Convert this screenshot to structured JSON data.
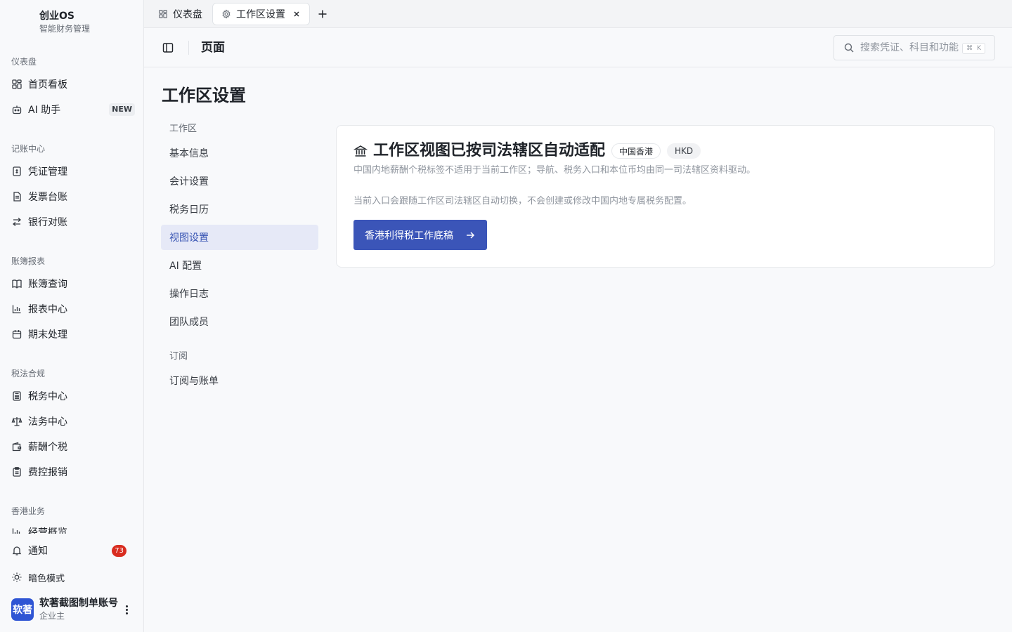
{
  "brand": {
    "name": "创业OS",
    "subtitle": "智能财务管理"
  },
  "sidebar": {
    "groups": [
      {
        "title": "仪表盘",
        "items": [
          {
            "label": "首页看板",
            "icon": "dashboard-grid-icon"
          },
          {
            "label": "AI 助手",
            "icon": "bot-icon",
            "badge": "NEW"
          }
        ]
      },
      {
        "title": "记账中心",
        "items": [
          {
            "label": "凭证管理",
            "icon": "receipt-icon"
          },
          {
            "label": "发票台账",
            "icon": "document-icon"
          },
          {
            "label": "银行对账",
            "icon": "swap-arrows-icon"
          }
        ]
      },
      {
        "title": "账簿报表",
        "items": [
          {
            "label": "账簿查询",
            "icon": "book-icon"
          },
          {
            "label": "报表中心",
            "icon": "bar-chart-icon"
          },
          {
            "label": "期末处理",
            "icon": "calendar-icon"
          }
        ]
      },
      {
        "title": "税法合规",
        "items": [
          {
            "label": "税务中心",
            "icon": "calculator-icon"
          },
          {
            "label": "法务中心",
            "icon": "scale-icon"
          },
          {
            "label": "薪酬个税",
            "icon": "wallet-icon"
          },
          {
            "label": "费控报销",
            "icon": "clipboard-icon"
          }
        ]
      },
      {
        "title": "香港业务",
        "items": [
          {
            "label": "经营概览",
            "icon": "bar-chart-icon"
          }
        ]
      }
    ],
    "bottom": {
      "notifications_label": "通知",
      "notifications_count": "73",
      "dark_mode_label": "暗色模式"
    },
    "user": {
      "avatar_text": "软著",
      "name": "软著截图制单账号",
      "role": "企业主"
    }
  },
  "tabs": [
    {
      "label": "仪表盘",
      "icon": "dashboard-grid-icon",
      "active": false
    },
    {
      "label": "工作区设置",
      "icon": "gear-icon",
      "active": true
    }
  ],
  "header": {
    "title": "页面",
    "search_placeholder": "搜索凭证、科目和功能",
    "search_shortcut_mod": "⌘",
    "search_shortcut_key": "K"
  },
  "main": {
    "page_title": "工作区设置",
    "subnav": [
      {
        "group": "工作区",
        "items": [
          "基本信息",
          "会计设置",
          "税务日历",
          "视图设置",
          "AI 配置",
          "操作日志",
          "团队成员"
        ]
      },
      {
        "group": "订阅",
        "items": [
          "订阅与账单"
        ]
      }
    ],
    "active_subnav": "视图设置",
    "card": {
      "icon": "bank-building-icon",
      "title": "工作区视图已按司法辖区自动适配",
      "region_pill": "中国香港",
      "currency_pill": "HKD",
      "description": "中国内地薪酬个税标签不适用于当前工作区；导航、税务入口和本位币均由同一司法辖区资料驱动。",
      "note": "当前入口会跟随工作区司法辖区自动切换，不会创建或修改中国内地专属税务配置。",
      "button_label": "香港利得税工作底稿"
    }
  },
  "colors": {
    "accent": "#3b55b8",
    "active_bg": "#e6e9f7",
    "danger": "#d92d20",
    "avatar": "#2f55d4"
  }
}
